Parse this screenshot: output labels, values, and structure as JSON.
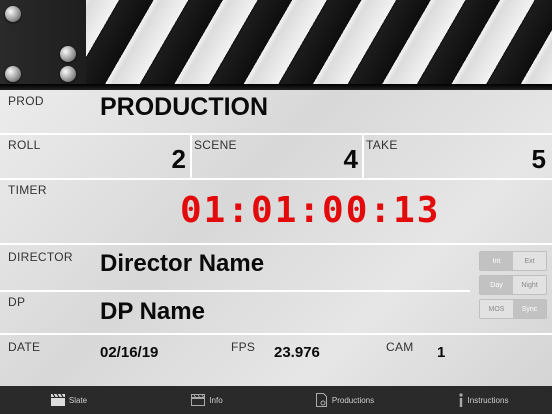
{
  "slate": {
    "prod": {
      "label": "PROD",
      "value": "PRODUCTION"
    },
    "roll": {
      "label": "ROLL",
      "value": "2"
    },
    "scene": {
      "label": "SCENE",
      "value": "4"
    },
    "take": {
      "label": "TAKE",
      "value": "5"
    },
    "timer": {
      "label": "TIMER",
      "value": "01:01:00:13"
    },
    "director": {
      "label": "DIRECTOR",
      "value": "Director Name"
    },
    "dp": {
      "label": "DP",
      "value": "DP Name"
    },
    "date": {
      "label": "DATE",
      "value": "02/16/19"
    },
    "fps": {
      "label": "FPS",
      "value": "23.976"
    },
    "cam": {
      "label": "CAM",
      "value": "1"
    }
  },
  "toggles": {
    "int_ext": {
      "left": "Int",
      "right": "Ext",
      "selected": "Int"
    },
    "day_night": {
      "left": "Day",
      "right": "Night",
      "selected": "Day"
    },
    "mos_sync": {
      "left": "MOS",
      "right": "Sync",
      "selected": "Sync"
    }
  },
  "colors": {
    "timer": "#e20a0a",
    "tabbar": "#2a2a2a"
  },
  "tabs": [
    {
      "label": "Slate",
      "icon": "clapperboard-icon"
    },
    {
      "label": "Info",
      "icon": "clapperboard-outline-icon"
    },
    {
      "label": "Productions",
      "icon": "document-gear-icon"
    },
    {
      "label": "Instructions",
      "icon": "info-icon"
    }
  ]
}
